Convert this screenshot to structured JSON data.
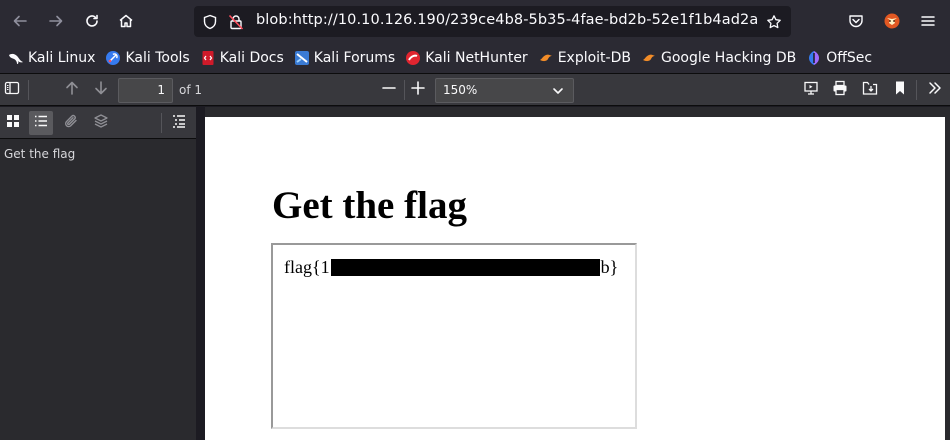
{
  "browser": {
    "url": "blob:http://10.10.126.190/239ce4b8-5b35-4fae-bd2b-52e1f1b4ad2a"
  },
  "bookmarks": [
    {
      "label": "Kali Linux",
      "icon": "kali-dragon-icon"
    },
    {
      "label": "Kali Tools",
      "icon": "kali-tools-icon"
    },
    {
      "label": "Kali Docs",
      "icon": "kali-docs-icon"
    },
    {
      "label": "Kali Forums",
      "icon": "kali-forums-icon"
    },
    {
      "label": "Kali NetHunter",
      "icon": "nethunter-icon"
    },
    {
      "label": "Exploit-DB",
      "icon": "exploit-db-icon"
    },
    {
      "label": "Google Hacking DB",
      "icon": "ghdb-icon"
    },
    {
      "label": "OffSec",
      "icon": "offsec-icon"
    }
  ],
  "pdf_toolbar": {
    "page_number": "1",
    "page_count_label": "of 1",
    "zoom_value": "150%"
  },
  "sidebar": {
    "outline": [
      "Get the flag"
    ]
  },
  "document": {
    "title": "Get the flag",
    "flag_prefix": "flag{1",
    "flag_suffix": "b}"
  },
  "colors": {
    "accent": "#0df",
    "toolbar_bg": "#38383d",
    "sidebar_bg": "#2a2a2e",
    "nav_bg": "#2b2a33"
  }
}
